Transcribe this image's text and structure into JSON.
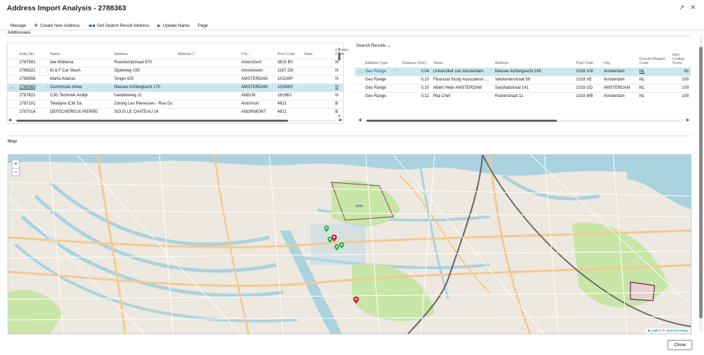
{
  "window": {
    "title": "Address Import Analysis - 2788363"
  },
  "actions": [
    {
      "label": "Manage",
      "icon": ""
    },
    {
      "label": "Create New Address",
      "icon": "plus-icon"
    },
    {
      "label": "Get Search Result Address",
      "icon": "rewind-icon"
    },
    {
      "label": "Update Name",
      "icon": "play-icon"
    },
    {
      "label": "Page",
      "icon": ""
    }
  ],
  "addresses": {
    "section_label": "Addresses",
    "columns": [
      "Entry No.",
      "Name",
      "Address",
      "Address 2",
      "City ↑",
      "Post Code",
      "State",
      "Country Code"
    ],
    "rows": [
      [
        "2787991",
        "Iwe Mollema",
        "Roerdompstraat 670",
        "",
        "Amersfoort",
        "3815 BV",
        "",
        "N"
      ],
      [
        "2788321",
        "M & F Car Wash",
        "Zijdelweg 195",
        "",
        "Amstelveen",
        "1187 ZM",
        "",
        "N"
      ],
      [
        "2788358",
        "Marta Adarias",
        "Singel 425",
        "",
        "AMSTERDAM",
        "1011WP",
        "",
        "N"
      ],
      [
        "2788363",
        "Commissie Intree",
        "Nieuwe Achtergracht 170",
        "",
        "AMSTERDAM",
        "1018WV",
        "",
        "N"
      ],
      [
        "2787821",
        "CJG Techniek Andijk",
        "handelsweg 21",
        "",
        "ANDIJK",
        "1619BJ",
        "",
        "N"
      ],
      [
        "2787101",
        "Teledyne ICM Sa.",
        "Zoning Les Plenesses - Rue Du",
        "",
        "Andrimort",
        "4821",
        "",
        "B"
      ],
      [
        "2787014",
        "DEFECHEREUX PIERRE",
        "SOUS LE CHATEAU 14",
        "",
        "ANDRIMONT",
        "4821",
        "",
        "B"
      ]
    ],
    "selected_index": 3
  },
  "search_results": {
    "section_label": "Search Results",
    "columns": [
      "Address Type",
      "Distance (Km) ↑",
      "Name",
      "Address",
      "Post Code",
      "City",
      "Country/Region Code",
      "Geo Coding Score"
    ],
    "rows": [
      [
        "Geo Range",
        "0,04",
        "Universiteit van Amsterdam",
        "Nieuwe Achtergracht 166",
        "1018 VW",
        "Amsterdam",
        "NL",
        "81"
      ],
      [
        "Geo Range",
        "0,10",
        "Financial Study Association Am...",
        "Valckenierstraat 59",
        "1018 XE",
        "Amsterdam",
        "NL",
        "100"
      ],
      [
        "Geo Range",
        "0,10",
        "Albert Heijn AMSTERDAM",
        "Sarphatistraat 141",
        "1018 GD",
        "AMSTERDAM",
        "NL",
        "100"
      ],
      [
        "Geo Range",
        "0,12",
        "Pita Chef",
        "Roeterstraat 11",
        "1018 WB",
        "Amsterdam",
        "NL",
        "100"
      ]
    ],
    "selected_index": 0
  },
  "map": {
    "label": "Map",
    "zoom_in": "+",
    "zoom_out": "−",
    "attribution_prefix": "■ Leaflet",
    "attribution_sep": " | © ",
    "attribution_osm": "OpenStreetMap",
    "place_labels": [
      "Artis"
    ],
    "marker_colors": {
      "result": "#2fb34a",
      "address": "#d6202a"
    }
  },
  "footer": {
    "close_label": "Close"
  },
  "colors": {
    "accent": "#1a5e8c",
    "selected_row": "#cbe8ee",
    "water": "#aad3df",
    "park": "#c8e6a8",
    "major_road": "#f6c98e"
  }
}
